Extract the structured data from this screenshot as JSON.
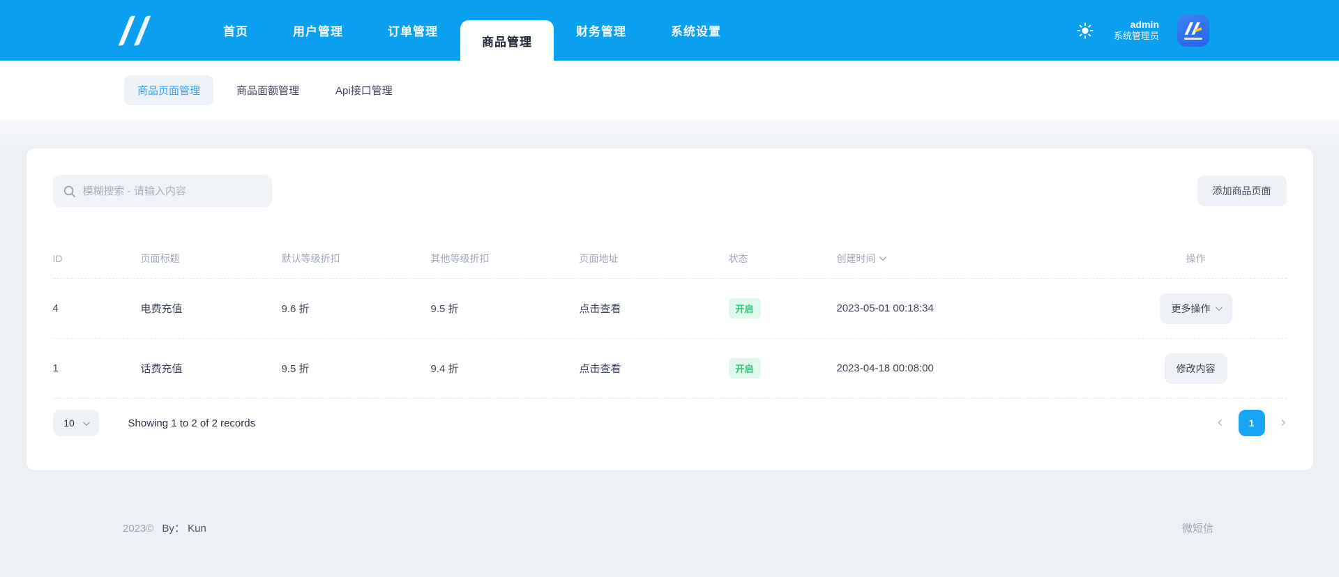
{
  "theme": {
    "header_bg": "#0b9ff0",
    "accent": "#18a5f3",
    "page_bg": "#edf0f5",
    "badge_text": "#2fc87e",
    "badge_bg": "#e1f8ec"
  },
  "header": {
    "nav": [
      {
        "label": "首页"
      },
      {
        "label": "用户管理"
      },
      {
        "label": "订单管理"
      },
      {
        "label": "商品管理",
        "active": true
      },
      {
        "label": "财务管理"
      },
      {
        "label": "系统设置"
      }
    ],
    "user": {
      "name": "admin",
      "role": "系统管理员"
    }
  },
  "subnav": {
    "tabs": [
      {
        "label": "商品页面管理",
        "active": true
      },
      {
        "label": "商品面额管理"
      },
      {
        "label": "Api接口管理"
      }
    ]
  },
  "toolbar": {
    "search_placeholder": "模糊搜索 - 请输入内容",
    "add_button": "添加商品页面"
  },
  "table": {
    "columns": {
      "id": "ID",
      "title": "页面标题",
      "default_discount": "默认等级折扣",
      "other_discount": "其他等级折扣",
      "page_link": "页面地址",
      "status": "状态",
      "created_at": "创建时间",
      "actions": "操作"
    },
    "sorted_column": "创建时间",
    "rows": [
      {
        "id": "4",
        "title": "电费充值",
        "default_discount": "9.6 折",
        "other_discount": "9.5 折",
        "page_link": "点击查看",
        "status": "开启",
        "created_at": "2023-05-01 00:18:34",
        "action": "更多操作"
      },
      {
        "id": "1",
        "title": "话费充值",
        "default_discount": "9.5 折",
        "other_discount": "9.4 折",
        "page_link": "点击查看",
        "status": "开启",
        "created_at": "2023-04-18 00:08:00",
        "action": "修改内容"
      }
    ]
  },
  "pagination": {
    "page_size": "10",
    "summary": "Showing 1 to 2 of 2 records",
    "current_page": "1",
    "prev": "‹",
    "next": "›"
  },
  "footer": {
    "copyright": "2023©",
    "by": "By： Kun",
    "right_link": "微短信"
  }
}
